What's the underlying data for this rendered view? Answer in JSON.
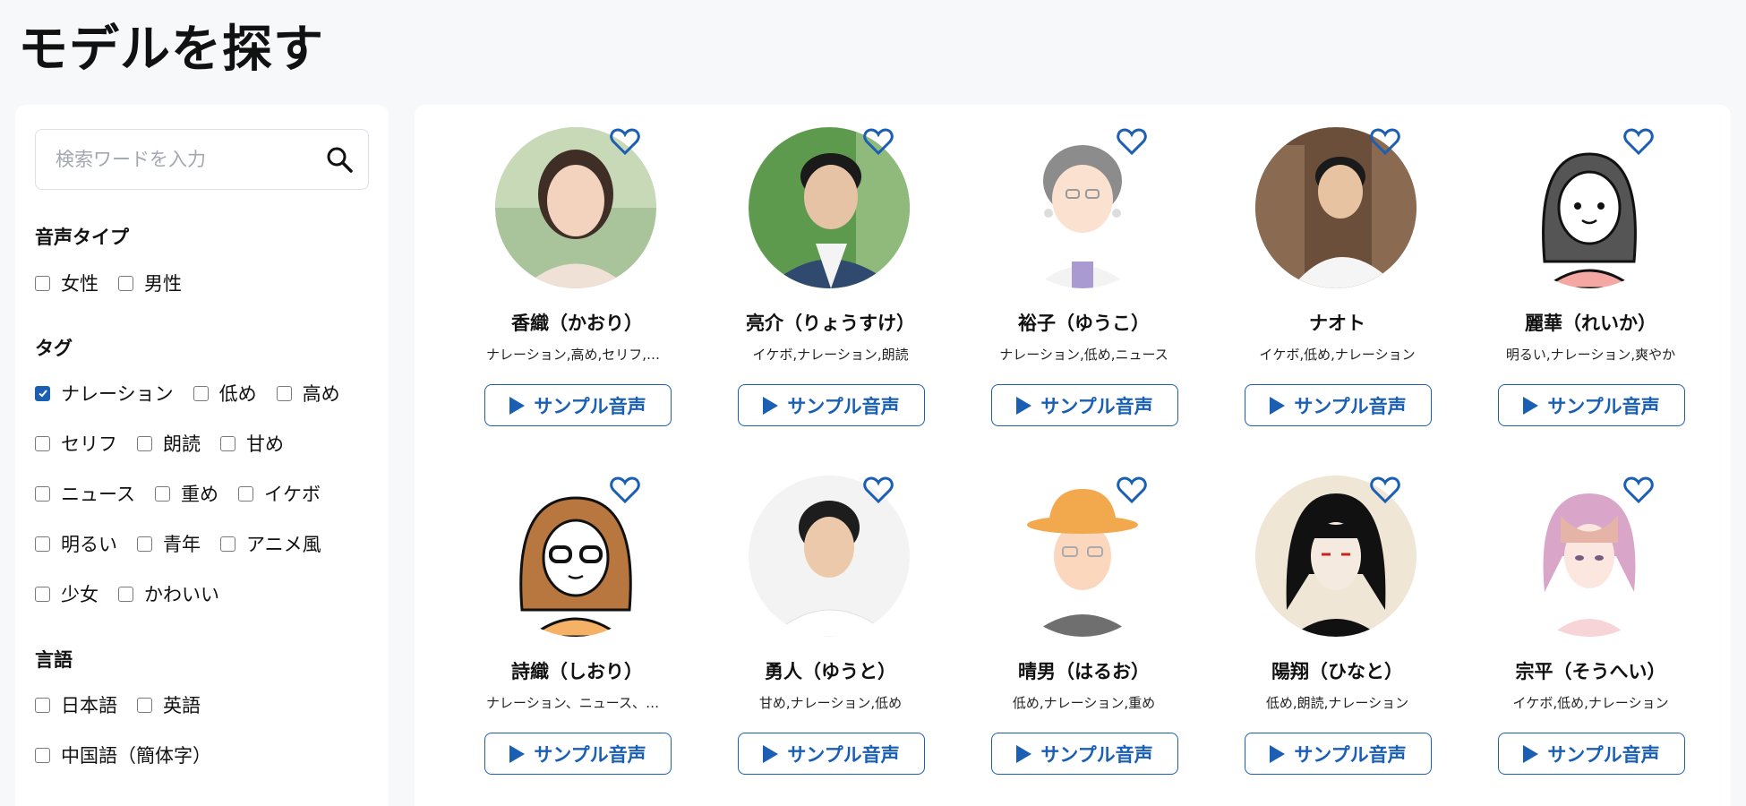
{
  "page_title": "モデルを探す",
  "search": {
    "placeholder": "検索ワードを入力",
    "value": ""
  },
  "filters": {
    "voice_type": {
      "title": "音声タイプ",
      "options": [
        {
          "label": "女性",
          "checked": false
        },
        {
          "label": "男性",
          "checked": false
        }
      ]
    },
    "tags": {
      "title": "タグ",
      "rows": [
        [
          {
            "label": "ナレーション",
            "checked": true
          },
          {
            "label": "低め",
            "checked": false
          },
          {
            "label": "高め",
            "checked": false
          }
        ],
        [
          {
            "label": "セリフ",
            "checked": false
          },
          {
            "label": "朗読",
            "checked": false
          },
          {
            "label": "甘め",
            "checked": false
          }
        ],
        [
          {
            "label": "ニュース",
            "checked": false
          },
          {
            "label": "重め",
            "checked": false
          },
          {
            "label": "イケボ",
            "checked": false
          }
        ],
        [
          {
            "label": "明るい",
            "checked": false
          },
          {
            "label": "青年",
            "checked": false
          },
          {
            "label": "アニメ風",
            "checked": false
          }
        ],
        [
          {
            "label": "少女",
            "checked": false
          },
          {
            "label": "かわいい",
            "checked": false
          }
        ]
      ]
    },
    "language": {
      "title": "言語",
      "rows": [
        [
          {
            "label": "日本語",
            "checked": false
          },
          {
            "label": "英語",
            "checked": false
          }
        ],
        [
          {
            "label": "中国語（簡体字）",
            "checked": false
          }
        ]
      ]
    }
  },
  "sample_button_label": "サンプル音声",
  "models": [
    {
      "name": "香織（かおり）",
      "tags": "ナレーション,高め,セリフ,朗読",
      "avatar": "photo-woman"
    },
    {
      "name": "亮介（りょうすけ）",
      "tags": "イケボ,ナレーション,朗読",
      "avatar": "photo-man-suit"
    },
    {
      "name": "裕子（ゆうこ）",
      "tags": "ナレーション,低め,ニュース",
      "avatar": "illustration-elderly-woman"
    },
    {
      "name": "ナオト",
      "tags": "イケボ,低め,ナレーション",
      "avatar": "photo-man-library"
    },
    {
      "name": "麗華（れいか）",
      "tags": "明るい,ナレーション,爽やか",
      "avatar": "illustration-woman"
    },
    {
      "name": "詩織（しおり）",
      "tags": "ナレーション、ニュース、セリフ",
      "avatar": "illustration-woman-glasses"
    },
    {
      "name": "勇人（ゆうと）",
      "tags": "甘め,ナレーション,低め",
      "avatar": "photo-young-man"
    },
    {
      "name": "晴男（はるお）",
      "tags": "低め,ナレーション,重め",
      "avatar": "illustration-man-hat"
    },
    {
      "name": "陽翔（ひなと）",
      "tags": "低め,朗読,ナレーション",
      "avatar": "anime-man-black-hair"
    },
    {
      "name": "宗平（そうへい）",
      "tags": "イケボ,低め,ナレーション",
      "avatar": "anime-boy-watercolor"
    }
  ],
  "colors": {
    "accent": "#1a5fb4",
    "background": "#f7f8fa",
    "panel": "#ffffff"
  }
}
